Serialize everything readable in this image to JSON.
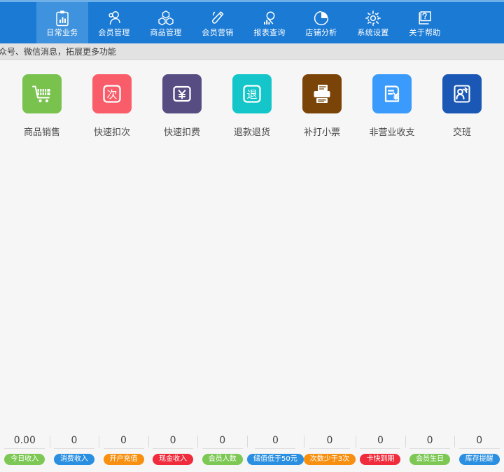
{
  "nav": {
    "active_index": 0,
    "background": "#1b7ad4",
    "active_background": "#3f92dd",
    "items": [
      {
        "label": "日常业务",
        "icon": "clipboard-chart-icon"
      },
      {
        "label": "会员管理",
        "icon": "member-person-icon"
      },
      {
        "label": "商品管理",
        "icon": "cubes-icon"
      },
      {
        "label": "会员营销",
        "icon": "megaphone-icon"
      },
      {
        "label": "报表查询",
        "icon": "report-search-icon"
      },
      {
        "label": "店铺分析",
        "icon": "pie-chart-icon"
      },
      {
        "label": "系统设置",
        "icon": "gear-icon"
      },
      {
        "label": "关于帮助",
        "icon": "help-screen-icon"
      }
    ]
  },
  "notice": {
    "text": "公众号、微信消息，拓展更多功能"
  },
  "tiles": [
    {
      "label": "商品销售",
      "icon": "shopping-cart-icon",
      "color": "#79c24e"
    },
    {
      "label": "快速扣次",
      "icon": "ci-count-icon",
      "color": "#fa5d6a"
    },
    {
      "label": "快速扣费",
      "icon": "yuan-fee-icon",
      "color": "#574d82"
    },
    {
      "label": "退款退货",
      "icon": "refund-icon",
      "color": "#14c6c9"
    },
    {
      "label": "补打小票",
      "icon": "printer-icon",
      "color": "#7a4409"
    },
    {
      "label": "非营业收支",
      "icon": "receipt-yuan-icon",
      "color": "#3a9bfc"
    },
    {
      "label": "交班",
      "icon": "shift-change-icon",
      "color": "#1b57b5"
    }
  ],
  "stats": [
    {
      "value": "0.00",
      "label": "今日收入",
      "color": "#7dc855"
    },
    {
      "value": "0",
      "label": "消费收入",
      "color": "#2a8fe0"
    },
    {
      "value": "0",
      "label": "开户充值",
      "color": "#f79010"
    },
    {
      "value": "0",
      "label": "现金收入",
      "color": "#f02b3c"
    },
    {
      "value": "0",
      "label": "会员人数",
      "color": "#7dc855"
    },
    {
      "value": "0",
      "label": "储值低于50元",
      "color": "#2a8fe0"
    },
    {
      "value": "0",
      "label": "次数少于3次",
      "color": "#f79010"
    },
    {
      "value": "0",
      "label": "卡快到期",
      "color": "#f02b3c"
    },
    {
      "value": "0",
      "label": "会员生日",
      "color": "#7dc855"
    },
    {
      "value": "0",
      "label": "库存提醒",
      "color": "#2a8fe0"
    }
  ]
}
